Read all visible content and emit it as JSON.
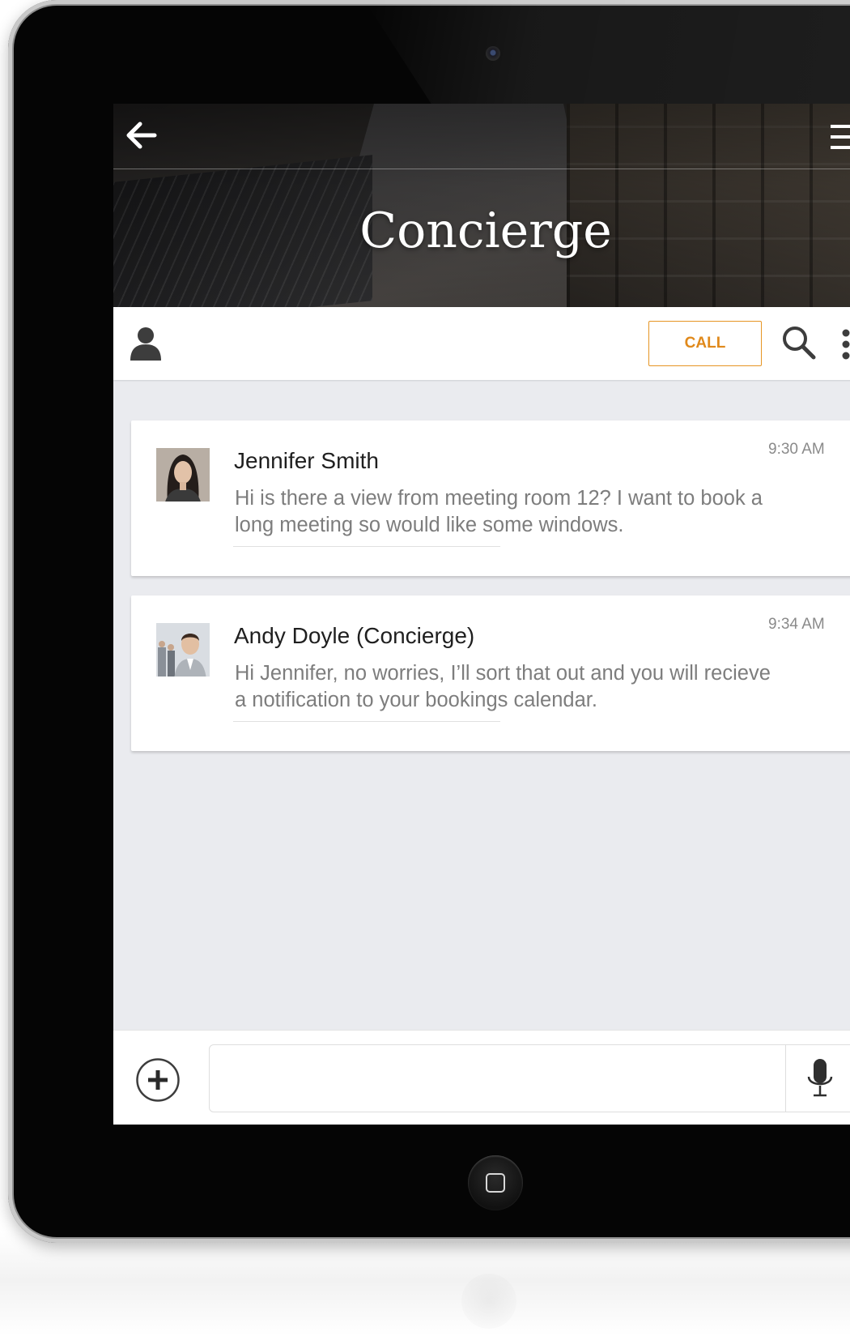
{
  "app": {
    "title": "Concierge"
  },
  "header": {
    "back_icon": "arrow-left-icon",
    "menu_icon": "hamburger-menu-icon"
  },
  "toolbar": {
    "profile_icon": "user-icon",
    "call_label": "CALL",
    "search_icon": "search-icon",
    "more_icon": "more-vertical-icon"
  },
  "messages": [
    {
      "sender": "Jennifer Smith",
      "time": "9:30 AM",
      "text": "Hi is there a view from meeting room 12? I want to book a long meeting so would like some windows."
    },
    {
      "sender": "Andy Doyle (Concierge)",
      "time": "9:34 AM",
      "text": "Hi Jennifer, no worries, I’ll sort that out and you will recieve a notification to your bookings calendar."
    }
  ],
  "composer": {
    "add_icon": "plus-circle-icon",
    "input_value": "",
    "mic_icon": "microphone-icon"
  },
  "colors": {
    "accent": "#e0891b",
    "screen_background": "#eaebef",
    "device_bezel": "#050505"
  }
}
